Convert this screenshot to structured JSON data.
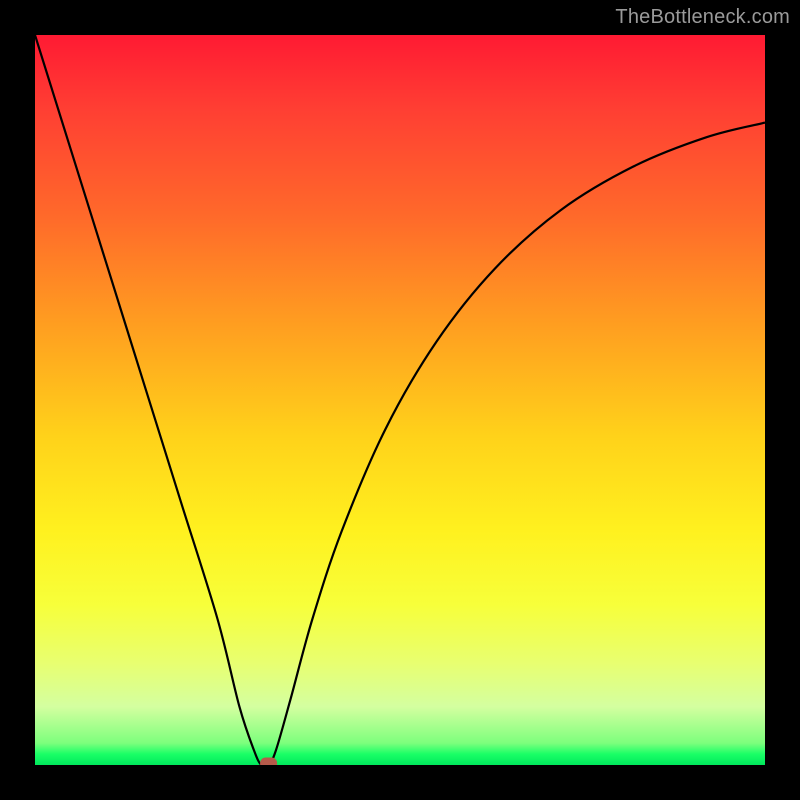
{
  "watermark": "TheBottleneck.com",
  "chart_data": {
    "type": "line",
    "title": "",
    "xlabel": "",
    "ylabel": "",
    "xlim": [
      0,
      100
    ],
    "ylim": [
      0,
      100
    ],
    "grid": false,
    "legend": false,
    "series": [
      {
        "name": "bottleneck-curve",
        "x": [
          0,
          5,
          10,
          15,
          20,
          25,
          28,
          30,
          31,
          32,
          33,
          35,
          38,
          42,
          48,
          55,
          63,
          72,
          82,
          92,
          100
        ],
        "values": [
          100,
          84,
          68,
          52,
          36,
          20,
          8,
          2,
          0,
          0,
          2,
          9,
          20,
          32,
          46,
          58,
          68,
          76,
          82,
          86,
          88
        ]
      }
    ],
    "marker": {
      "x": 32,
      "y": 0,
      "shape": "rounded-rect",
      "color": "#b55a4a"
    },
    "gradient_colors": {
      "top": "#ff1a33",
      "mid_upper": "#ff9f20",
      "mid": "#fff11f",
      "mid_lower": "#d4ffa0",
      "bottom": "#00e85c"
    }
  }
}
